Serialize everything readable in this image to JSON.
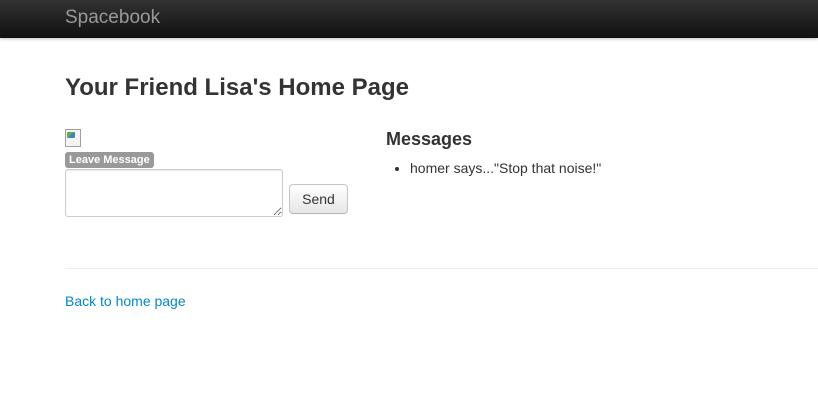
{
  "navbar": {
    "brand": "Spacebook"
  },
  "page": {
    "title": "Your Friend Lisa's Home Page"
  },
  "leave_message": {
    "label": "Leave Message",
    "textarea_value": "",
    "send_label": "Send"
  },
  "messages": {
    "heading": "Messages",
    "items": [
      {
        "text": "homer says...\"Stop that noise!\""
      }
    ]
  },
  "footer": {
    "back_link": "Back to home page"
  },
  "colors": {
    "navbar_bg": "#1b1b1b",
    "brand_text": "#999999",
    "link": "#0088cc",
    "label_bg": "#999999"
  },
  "icons": {
    "profile_image": "broken-image-icon"
  }
}
